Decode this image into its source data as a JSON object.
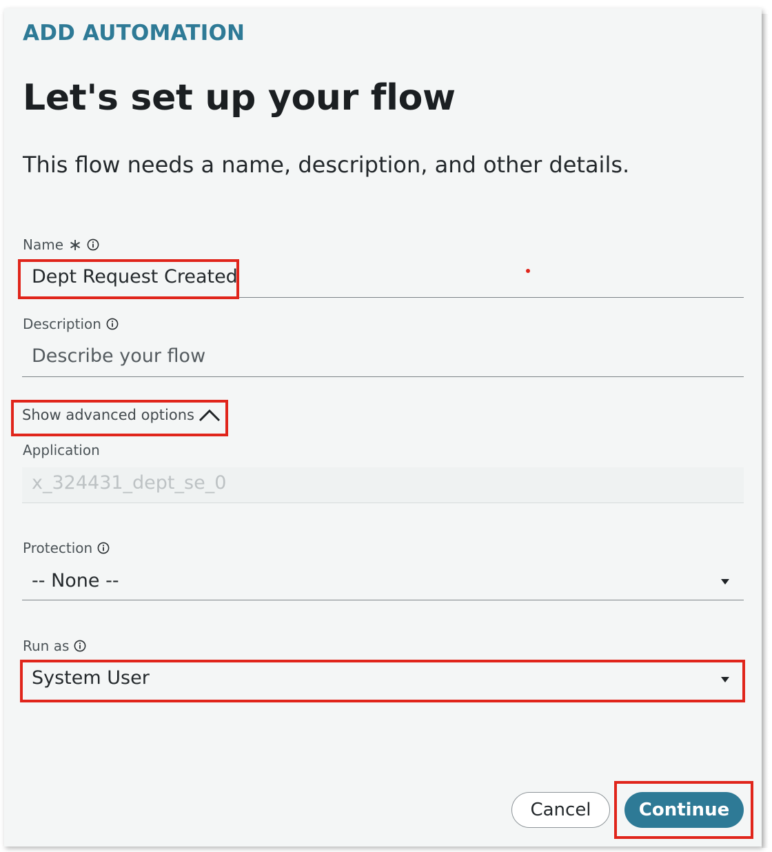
{
  "header": {
    "label": "ADD AUTOMATION"
  },
  "page": {
    "title": "Let's set up your flow",
    "subtitle": "This flow needs a name, description, and other details."
  },
  "form": {
    "name": {
      "label": "Name",
      "required": true,
      "value": "Dept Request Created",
      "icon": "info-icon"
    },
    "description": {
      "label": "Description",
      "placeholder": "Describe your flow",
      "icon": "info-icon"
    },
    "advanced_toggle": {
      "label": "Show advanced options",
      "expanded": true,
      "icon": "chevron-up-icon"
    },
    "application": {
      "label": "Application",
      "value": "x_324431_dept_se_0",
      "disabled": true
    },
    "protection": {
      "label": "Protection",
      "selected": "-- None --",
      "icon": "info-icon"
    },
    "run_as": {
      "label": "Run as",
      "selected": "System User",
      "icon": "info-icon"
    }
  },
  "actions": {
    "cancel_label": "Cancel",
    "continue_label": "Continue"
  },
  "colors": {
    "accent": "#2e7a96",
    "highlight": "#e0251b",
    "background": "#f4f6f6"
  }
}
